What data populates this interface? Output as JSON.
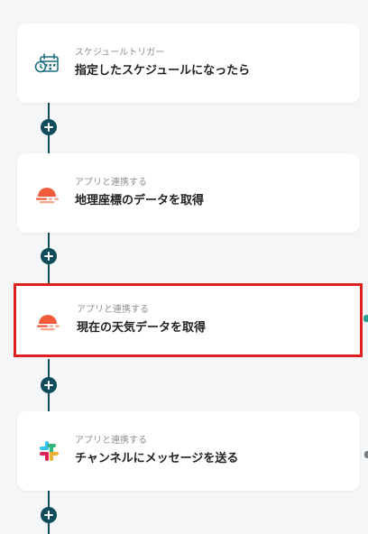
{
  "flow": {
    "steps": [
      {
        "sub": "スケジュールトリガー",
        "title": "指定したスケジュールになったら",
        "icon": "calendar-clock-icon"
      },
      {
        "sub": "アプリと連携する",
        "title": "地理座標のデータを取得",
        "icon": "weather-app-icon"
      },
      {
        "sub": "アプリと連携する",
        "title": "現在の天気データを取得",
        "icon": "weather-app-icon",
        "selected": true
      },
      {
        "sub": "アプリと連携する",
        "title": "チャンネルにメッセージを送る",
        "icon": "slack-icon"
      }
    ],
    "add_button_symbol": "+"
  },
  "colors": {
    "connector": "#0f4c5c",
    "selection_border": "#e02020",
    "weather_icon": "#f15b3c",
    "calendar_icon": "#1d6f80"
  }
}
